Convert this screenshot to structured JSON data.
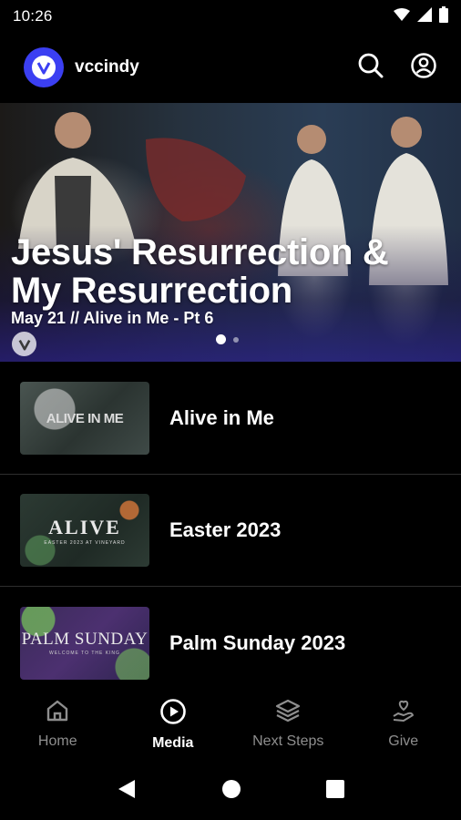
{
  "status_bar": {
    "time": "10:26",
    "icons": [
      "wifi-icon",
      "signal-icon",
      "battery-icon"
    ]
  },
  "app_bar": {
    "app_name": "vccindy",
    "logo_letter": "V",
    "actions": [
      "search-icon",
      "account-icon"
    ]
  },
  "hero": {
    "title": "Jesus' Resurrection & My Resurrection",
    "subtitle": "May 21 // Alive in Me - Pt 6",
    "badge_letter": "V",
    "page_count": 2,
    "active_page": 1
  },
  "media": {
    "items": [
      {
        "title": "Alive in Me",
        "thumb_text": "ALIVE IN ME",
        "thumb_sub": ""
      },
      {
        "title": "Easter 2023",
        "thumb_text": "ALIVE",
        "thumb_sub": "EASTER 2023 AT VINEYARD"
      },
      {
        "title": "Palm Sunday 2023",
        "thumb_text": "PALM SUNDAY",
        "thumb_sub": "WELCOME TO THE KING"
      }
    ]
  },
  "bottom_nav": {
    "items": [
      {
        "label": "Home",
        "icon": "home-icon"
      },
      {
        "label": "Media",
        "icon": "play-circle-icon"
      },
      {
        "label": "Next Steps",
        "icon": "layers-icon"
      },
      {
        "label": "Give",
        "icon": "give-hand-heart-icon"
      }
    ],
    "active": "Media"
  },
  "system_nav": [
    "back-icon",
    "home-circle-icon",
    "recents-square-icon"
  ]
}
